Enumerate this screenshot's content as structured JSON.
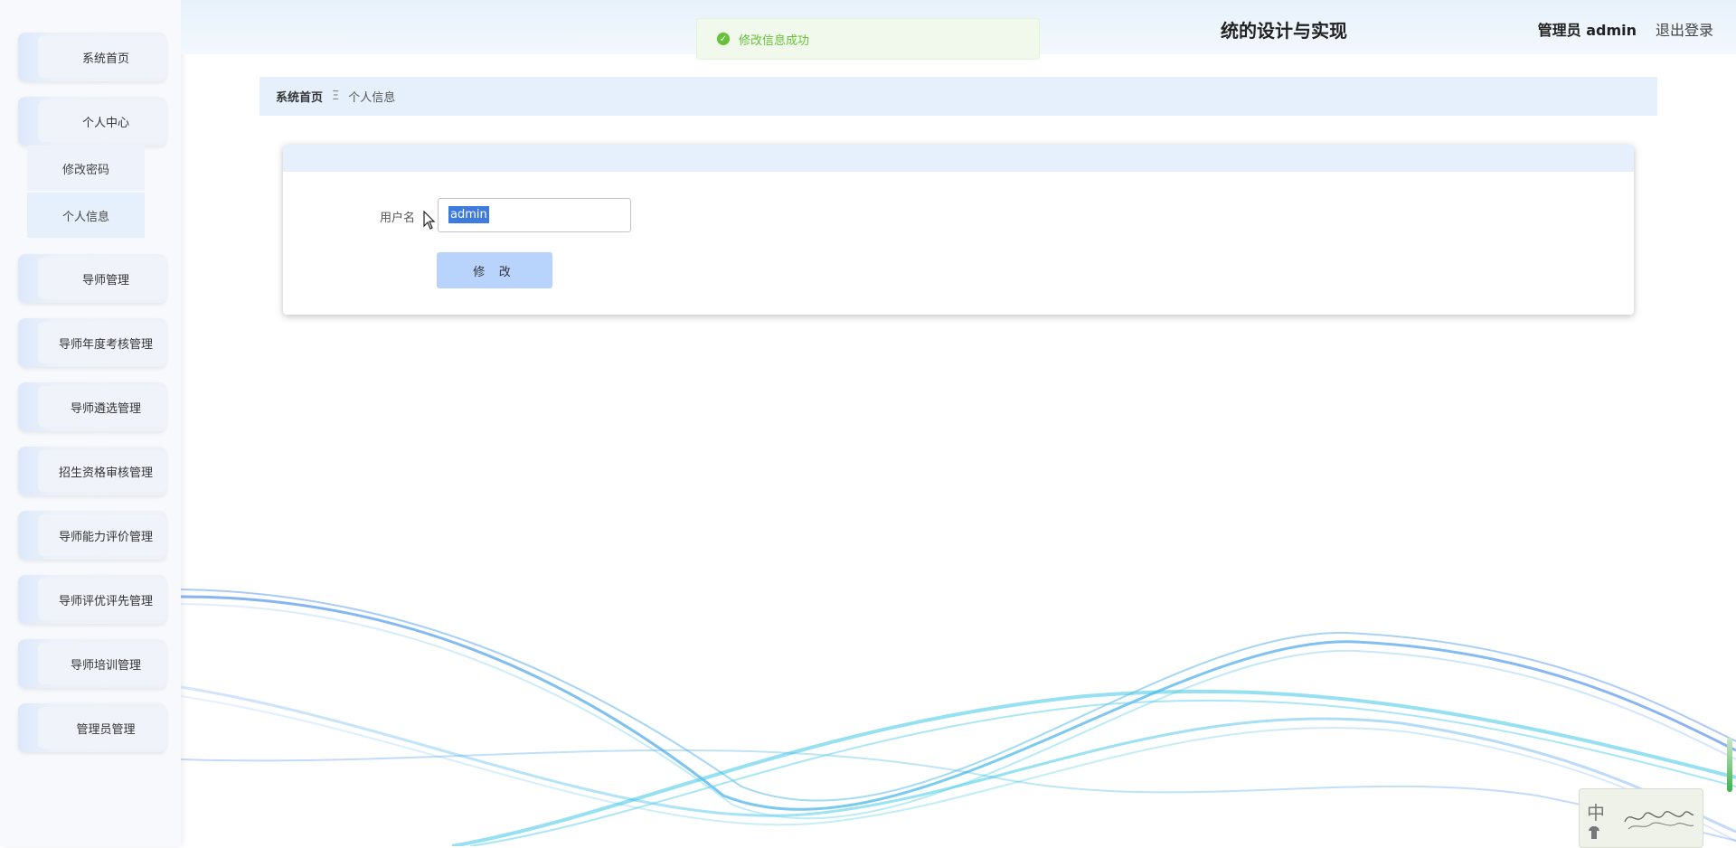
{
  "header": {
    "title": "统的设计与实现",
    "user": "管理员 admin",
    "logout": "退出登录"
  },
  "toast": {
    "message": "修改信息成功"
  },
  "sidebar": {
    "items": [
      {
        "label": "系统首页"
      },
      {
        "label": "个人中心"
      },
      {
        "label": "导师管理"
      },
      {
        "label": "导师年度考核管理"
      },
      {
        "label": "导师遴选管理"
      },
      {
        "label": "招生资格审核管理"
      },
      {
        "label": "导师能力评价管理"
      },
      {
        "label": "导师评优评先管理"
      },
      {
        "label": "导师培训管理"
      },
      {
        "label": "管理员管理"
      }
    ],
    "submenu": [
      {
        "label": "修改密码"
      },
      {
        "label": "个人信息"
      }
    ]
  },
  "breadcrumb": {
    "home": "系统首页",
    "separator": "Ξ",
    "current": "个人信息"
  },
  "form": {
    "username_label": "用户名",
    "username_value": "admin",
    "submit": "修 改"
  },
  "ime": {
    "char": "中"
  },
  "colors": {
    "accent": "#b8d3fc",
    "success": "#67c23a",
    "header_bg": "#e6f0fd"
  }
}
